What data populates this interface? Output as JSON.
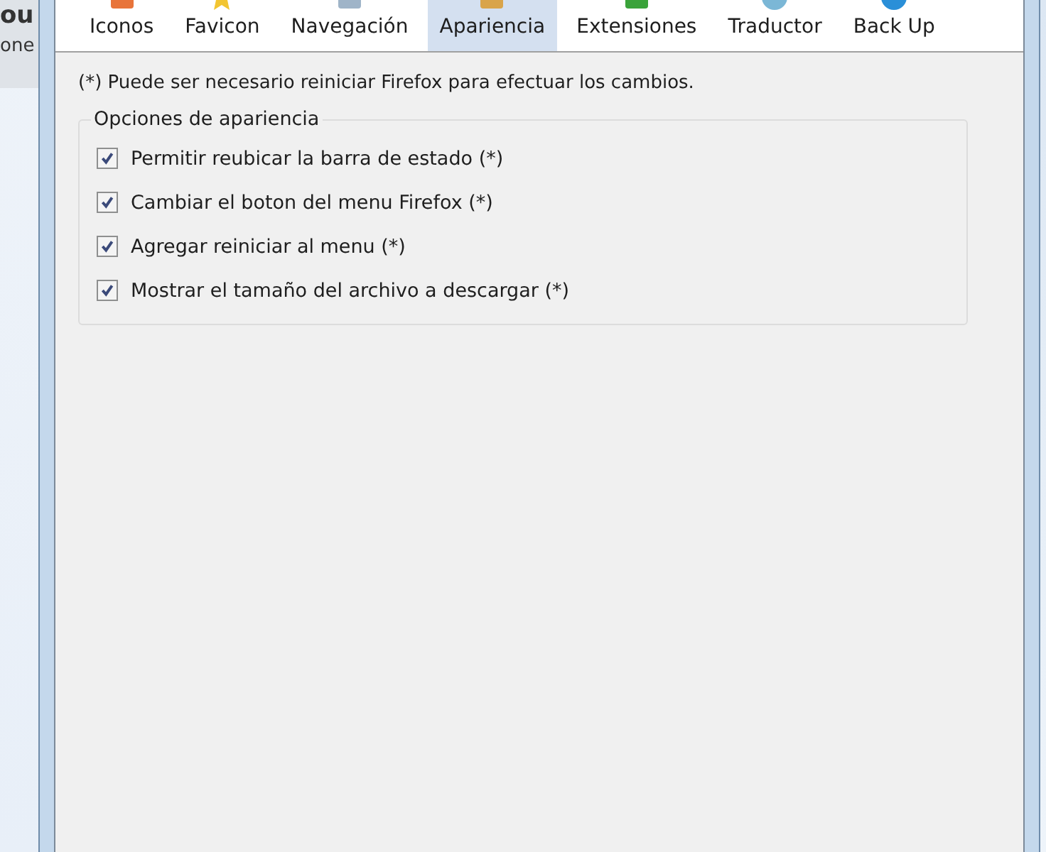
{
  "background_window": {
    "title": "ou",
    "label": "one"
  },
  "tabs": [
    {
      "label": "Iconos",
      "selected": false
    },
    {
      "label": "Favicon",
      "selected": false
    },
    {
      "label": "Navegación",
      "selected": false
    },
    {
      "label": "Apariencia",
      "selected": true
    },
    {
      "label": "Extensiones",
      "selected": false
    },
    {
      "label": "Traductor",
      "selected": false
    },
    {
      "label": "Back Up",
      "selected": false
    }
  ],
  "note": "(*) Puede ser necesario reiniciar Firefox para efectuar los cambios.",
  "group": {
    "title": "Opciones de apariencia",
    "options": [
      {
        "label": "Permitir reubicar la barra de estado (*)",
        "checked": true
      },
      {
        "label": "Cambiar el boton del menu Firefox (*)",
        "checked": true
      },
      {
        "label": "Agregar reiniciar al menu (*)",
        "checked": true
      },
      {
        "label": "Mostrar el tamaño del archivo a descargar (*)",
        "checked": true
      }
    ]
  }
}
